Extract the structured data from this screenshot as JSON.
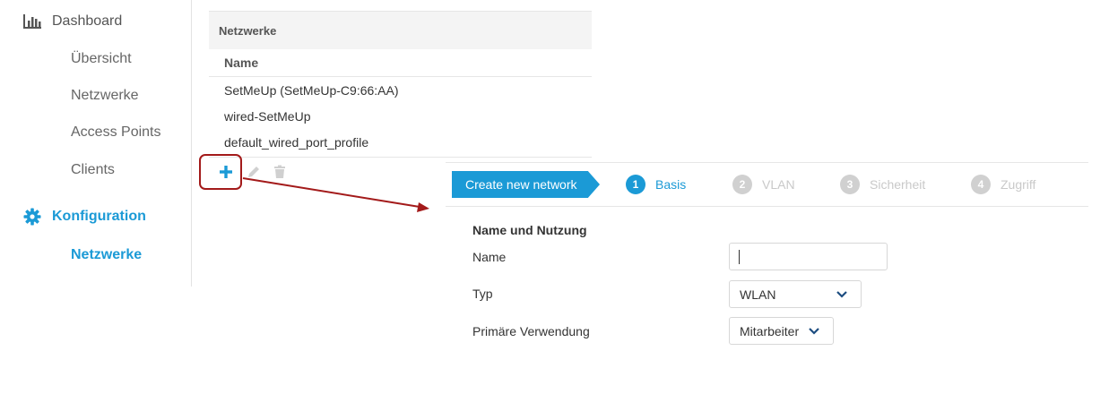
{
  "sidebar": {
    "dashboard": {
      "label": "Dashboard",
      "icon": "bar-chart-icon"
    },
    "dashboard_items": [
      "Übersicht",
      "Netzwerke",
      "Access Points",
      "Clients"
    ],
    "config": {
      "label": "Konfiguration",
      "icon": "gear-icon"
    },
    "config_items": [
      "Netzwerke"
    ],
    "active_item": "Netzwerke"
  },
  "networks_panel": {
    "title": "Netzwerke",
    "column": "Name",
    "rows": [
      "SetMeUp (SetMeUp-C9:66:AA)",
      "wired-SetMeUp",
      "default_wired_port_profile"
    ],
    "toolbar": {
      "add_icon": "plus-icon",
      "edit_icon": "pencil-icon",
      "delete_icon": "trash-icon"
    }
  },
  "wizard": {
    "create_label": "Create new network",
    "steps": [
      {
        "num": "1",
        "label": "Basis",
        "active": true
      },
      {
        "num": "2",
        "label": "VLAN",
        "active": false
      },
      {
        "num": "3",
        "label": "Sicherheit",
        "active": false
      },
      {
        "num": "4",
        "label": "Zugriff",
        "active": false
      }
    ],
    "section_title": "Name und Nutzung",
    "fields": {
      "name_label": "Name",
      "name_value": "",
      "type_label": "Typ",
      "type_value": "WLAN",
      "usage_label": "Primäre Verwendung",
      "usage_value": "Mitarbeiter"
    }
  },
  "colors": {
    "accent": "#1b9ad6",
    "highlight": "#a31a1a",
    "inactive": "#d0d0d0"
  }
}
